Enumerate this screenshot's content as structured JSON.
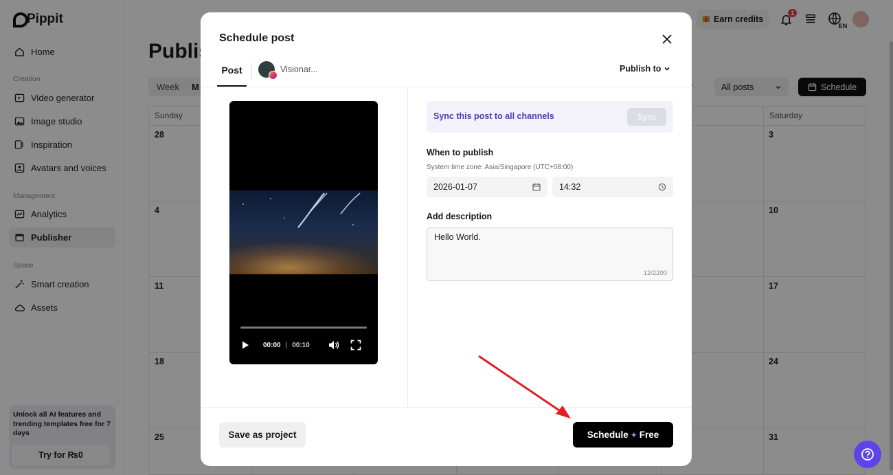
{
  "app": {
    "name": "Pippit"
  },
  "sidebar": {
    "home": "Home",
    "section_creation": "Creation",
    "creation_items": [
      "Video generator",
      "Image studio",
      "Inspiration",
      "Avatars and voices"
    ],
    "section_management": "Management",
    "management_items": [
      "Analytics",
      "Publisher"
    ],
    "section_space": "Space",
    "space_items": [
      "Smart creation",
      "Assets"
    ],
    "promo_text": "Unlock all AI features and trending templates free for 7 days",
    "promo_button": "Try for ₨0"
  },
  "topbar": {
    "earn_credits": "Earn credits",
    "notif_count": "1",
    "lang": "EN"
  },
  "page": {
    "title": "Publis",
    "view_week": "Week",
    "view_month": "M",
    "filter": "All posts",
    "schedule_button": "Schedule",
    "day_sunday": "Sunday",
    "day_saturday": "Saturday",
    "sunday_dates": [
      "28",
      "4",
      "11",
      "18",
      "25"
    ],
    "saturday_dates": [
      "3",
      "10",
      "17",
      "24",
      "31"
    ]
  },
  "modal": {
    "title": "Schedule post",
    "tab_post": "Post",
    "account_name": "Visionar...",
    "publish_to": "Publish to",
    "video_current": "00:00",
    "video_duration": "00:10",
    "sync_text": "Sync this post to all channels",
    "sync_button": "Sync",
    "when_label": "When to publish",
    "timezone": "System time zone: Asia/Singapore (UTC+08:00)",
    "date": "2026-01-07",
    "time": "14:32",
    "desc_label": "Add description",
    "description": "Hello World.",
    "char_count": "12/2200",
    "save_button": "Save as project",
    "schedule_button": "Schedule",
    "schedule_free": "Free"
  },
  "colors": {
    "accent": "#5b45e8",
    "sync_text": "#4b3fae",
    "arrow": "#e02020"
  }
}
